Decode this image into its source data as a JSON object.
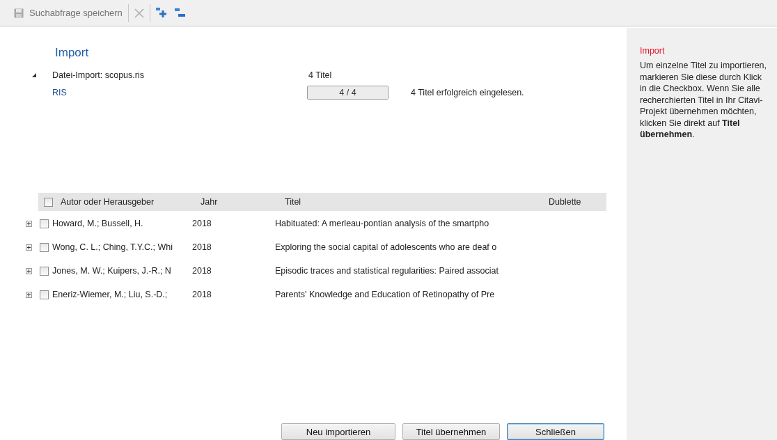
{
  "toolbar": {
    "items": [
      {
        "kind": "save",
        "label": "Suchabfrage speichern",
        "disabled": true
      },
      {
        "kind": "delete",
        "disabled": true
      },
      {
        "kind": "expand",
        "disabled": false
      },
      {
        "kind": "collapse",
        "disabled": false
      }
    ]
  },
  "import": {
    "title": "Import",
    "source": {
      "label": "Datei-Import: scopus.ris",
      "count": "4 Titel",
      "expanded": true
    },
    "format": {
      "label": "RIS",
      "progress_text": "4 / 4",
      "level": 1,
      "message": "4 Titel erfolgreich eingelesen."
    }
  },
  "table": {
    "select_all": {
      "checked": false
    },
    "columns": [
      "Autor oder Herausgeber",
      "Jahr",
      "Titel",
      "Dublette"
    ],
    "rows": [
      {
        "expanded": false,
        "checked": false,
        "author": "Howard, M.; Bussell, H.",
        "year": "2018",
        "title": "Habituated: A merleau-pontian analysis of the smartpho"
      },
      {
        "expanded": false,
        "checked": false,
        "author": "Wong, C. L.; Ching, T.Y.C.; Whi",
        "year": "2018",
        "title": "Exploring the social capital of adolescents who are deaf o"
      },
      {
        "expanded": false,
        "checked": false,
        "author": "Jones, M. W.; Kuipers, J.-R.; N",
        "year": "2018",
        "title": "Episodic traces and statistical regularities: Paired associat"
      },
      {
        "expanded": false,
        "checked": false,
        "author": "Eneriz-Wiemer, M.; Liu, S.-D.;",
        "year": "2018",
        "title": "Parents' Knowledge and Education of Retinopathy of Pre"
      }
    ]
  },
  "buttons": [
    {
      "label": "Neu importieren",
      "default": false
    },
    {
      "label": "Titel übernehmen",
      "default": false
    },
    {
      "label": "Schließen",
      "default": true
    }
  ],
  "help": {
    "title": "Import",
    "text": "Um einzelne Titel zu importieren, markieren Sie diese durch Klick in die Checkbox. Wenn Sie alle recherchierten Titel in Ihr Citavi-Projekt übernehmen möchten, klicken Sie direkt auf **Titel übernehmen**."
  }
}
